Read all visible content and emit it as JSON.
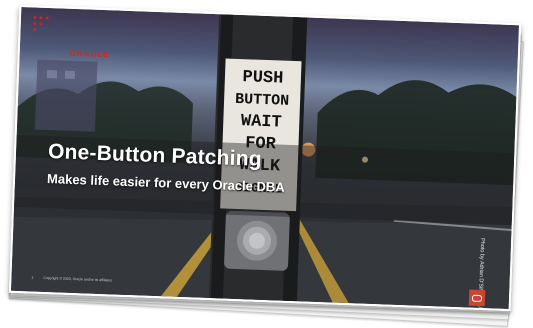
{
  "slide": {
    "title": "One-Button Patching",
    "subtitle": "Makes life easier for every Oracle DBA",
    "logo_text": "ORACLE",
    "copyright": "Copyright © 2020, Oracle and/or its affiliates",
    "page_number": "1",
    "photo_credit": "Photo by Adrian D'Silva on Unsplash"
  },
  "sign": {
    "lines": [
      "PUSH",
      "BUTTON",
      "WAIT",
      "FOR",
      "WALK",
      "SIGNAL"
    ]
  },
  "colors": {
    "oracle_red": "#c74634",
    "sky_top": "#3e3650",
    "road_line": "#c9a03a"
  },
  "icons": {
    "logo_pattern": "dot-grid-pattern",
    "badge": "oracle-o-icon"
  }
}
